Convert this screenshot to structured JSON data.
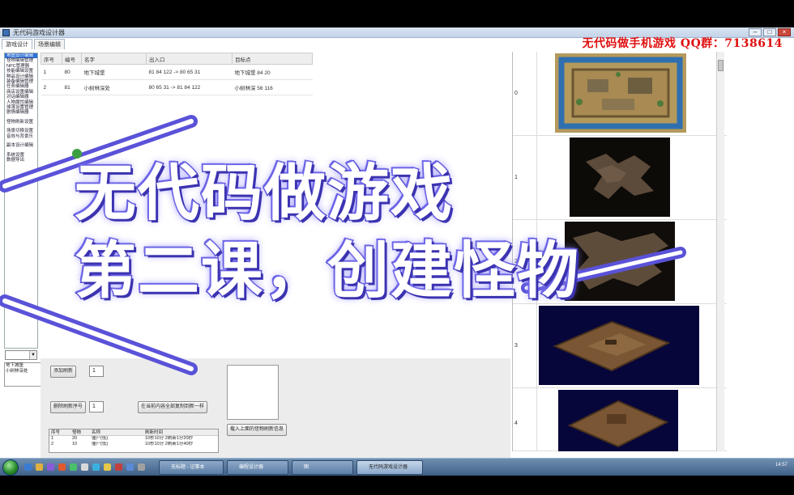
{
  "window": {
    "title": "无代码游戏设计器"
  },
  "watermark": "无代码做手机游戏 QQ群：7138614",
  "tabs": [
    {
      "label": "游戏设计"
    },
    {
      "label": "场景编辑"
    }
  ],
  "left_panel": {
    "items": [
      "地图设计编辑",
      "怪物编辑管理",
      "NPC管理器",
      "技能编辑设置",
      "物品设计编辑",
      "装备编辑管理",
      "任务编辑器",
      "商店设置编辑",
      "对话编辑器",
      "人物属性编辑",
      "掉落设置管理",
      "剧情编辑器",
      "",
      "怪物刷新设置",
      "",
      "场景切换设置",
      "音效与背景乐",
      "",
      "副本设计编辑",
      "",
      "系统设置",
      "数据导出",
      ""
    ],
    "combo_value": "",
    "mini_list": [
      "地下城堡",
      "小树林深处"
    ]
  },
  "map_table": {
    "headers": [
      "序号",
      "编号",
      "名字",
      "出入口",
      "目标点"
    ],
    "rows": [
      [
        "1",
        "80",
        "地下城堡",
        "81 84 122 -> 80 65 31",
        "地下城堡 84 20"
      ],
      [
        "2",
        "81",
        "小树林深处",
        "80 65 31 -> 81 84 122",
        "小树林深 56 116"
      ]
    ]
  },
  "controls": {
    "add_btn": "添加刷新",
    "add_count": "1",
    "delete_btn": "删除刷新序号",
    "delete_count": "1",
    "sync_btn": "在当前内容全部复制到新一样",
    "load_btn": "载入上面的怪物刷新信息"
  },
  "spawn_table": {
    "headers": [
      "序号",
      "怪物",
      "名称",
      "刷新时间"
    ],
    "rows": [
      [
        "1",
        "20",
        "僵尸(低)",
        "10秒10分 2刷新1分20秒"
      ],
      [
        "2",
        "10",
        "僵尸(低)",
        "10秒10分 2刷新1分40秒"
      ]
    ]
  },
  "map_list": {
    "indices": [
      "0",
      "1",
      "2",
      "3",
      "4"
    ]
  },
  "taskbar": {
    "buttons": [
      "无标题 - 记事本",
      "编程设计器",
      "图",
      "无代码游戏设计器"
    ],
    "clock": "14:57"
  },
  "overlay": {
    "line1": "无代码做游戏",
    "line2": "第二课，创建怪物"
  }
}
